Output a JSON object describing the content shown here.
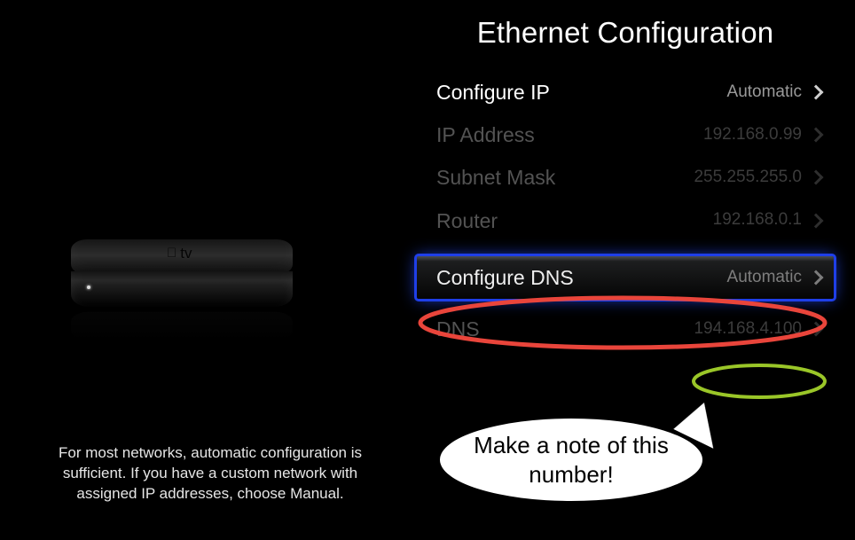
{
  "title": "Ethernet Configuration",
  "help_text": "For most networks, automatic configuration is sufficient. If you have a custom network with assigned IP addresses, choose Manual.",
  "device_label": "tv",
  "rows": [
    {
      "label": "Configure IP",
      "value": "Automatic",
      "state": "active"
    },
    {
      "label": "IP Address",
      "value": "192.168.0.99",
      "state": "dim"
    },
    {
      "label": "Subnet Mask",
      "value": "255.255.255.0",
      "state": "dim"
    },
    {
      "label": "Router",
      "value": "192.168.0.1",
      "state": "dim"
    },
    {
      "label": "Configure DNS",
      "value": "Automatic",
      "state": "selected"
    },
    {
      "label": "DNS",
      "value": "194.168.4.100",
      "state": "dim"
    }
  ],
  "annotations": {
    "red_oval_target": "Configure DNS",
    "green_oval_target": "DNS value",
    "callout_text": "Make a note of this number!"
  }
}
